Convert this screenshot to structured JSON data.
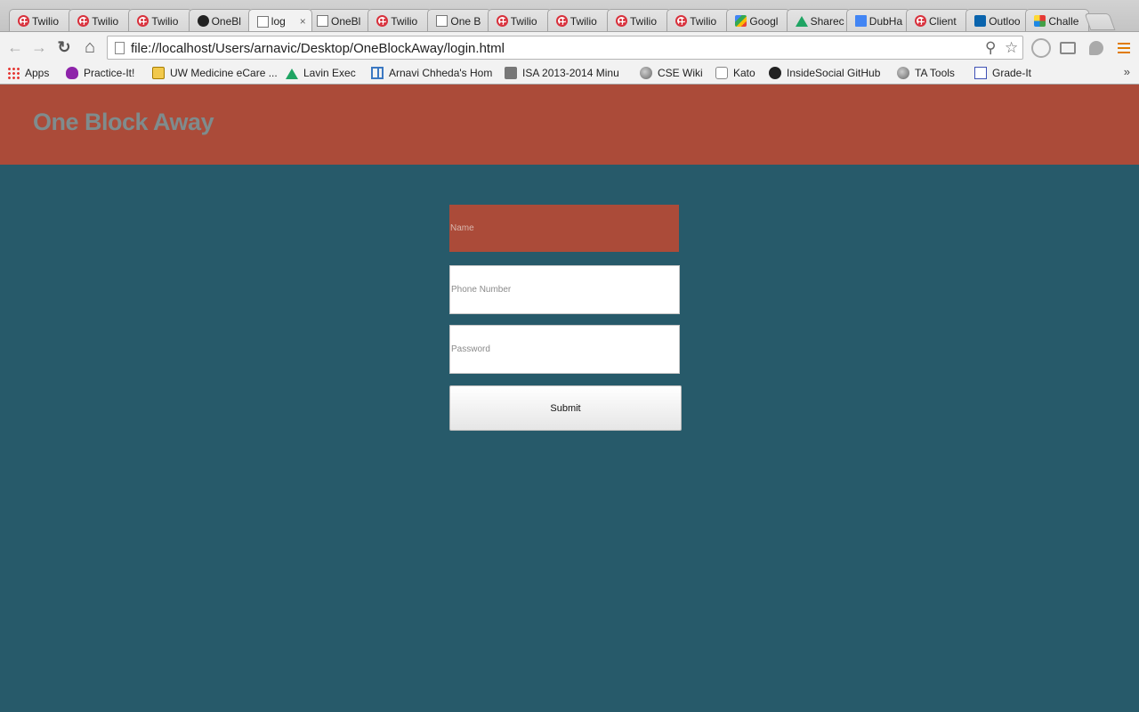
{
  "browser": {
    "tabs": [
      {
        "label": "Twilio",
        "icon": "twilio-icon"
      },
      {
        "label": "Twilio",
        "icon": "twilio-icon"
      },
      {
        "label": "Twilio",
        "icon": "twilio-icon"
      },
      {
        "label": "OneBl",
        "icon": "github-icon"
      },
      {
        "label": "log",
        "icon": "page-icon",
        "active": true
      },
      {
        "label": "OneBl",
        "icon": "page-icon"
      },
      {
        "label": "Twilio",
        "icon": "twilio-icon"
      },
      {
        "label": "One B",
        "icon": "page-icon"
      },
      {
        "label": "Twilio",
        "icon": "twilio-icon"
      },
      {
        "label": "Twilio",
        "icon": "twilio-icon"
      },
      {
        "label": "Twilio",
        "icon": "twilio-icon"
      },
      {
        "label": "Twilio",
        "icon": "twilio-icon"
      },
      {
        "label": "Googl",
        "icon": "google-icon"
      },
      {
        "label": "Sharec",
        "icon": "drive-icon"
      },
      {
        "label": "DubHa",
        "icon": "docs-icon"
      },
      {
        "label": "Client",
        "icon": "twilio-icon"
      },
      {
        "label": "Outloo",
        "icon": "outlook-icon"
      },
      {
        "label": "Challe",
        "icon": "pinwheel-icon"
      }
    ],
    "tab_close_glyph": "×",
    "url": "file://localhost/Users/arnavic/Desktop/OneBlockAway/login.html",
    "nav": {
      "back_glyph": "←",
      "forward_glyph": "→",
      "reload_glyph": "↻",
      "home_glyph": "⌂"
    },
    "omnibox_icons": {
      "search_glyph": "⚲",
      "star_glyph": "☆"
    },
    "bookmarks": [
      {
        "label": "Apps",
        "icon": "apps-grid-icon"
      },
      {
        "label": "Practice-It!",
        "icon": "bug-icon"
      },
      {
        "label": "UW Medicine eCare ...",
        "icon": "uw-icon"
      },
      {
        "label": "Lavin Exec",
        "icon": "drive-icon"
      },
      {
        "label": "Arnavi Chheda's Hom",
        "icon": "table-icon"
      },
      {
        "label": "ISA 2013-2014 Minu",
        "icon": "folder-icon"
      },
      {
        "label": "CSE Wiki",
        "icon": "globe-icon"
      },
      {
        "label": "Kato",
        "icon": "cat-icon"
      },
      {
        "label": "InsideSocial GitHub",
        "icon": "github-icon"
      },
      {
        "label": "TA Tools",
        "icon": "globe-icon"
      },
      {
        "label": "Grade-It",
        "icon": "checkbox-icon"
      }
    ],
    "bookmarks_more": "»"
  },
  "page": {
    "title": "One Block Away",
    "colors": {
      "header": "#ab4b39",
      "background": "#275a6a",
      "title": "#7f8c8d"
    },
    "form": {
      "name_placeholder": "Name",
      "phone_placeholder": "Phone Number",
      "password_placeholder": "Password",
      "submit_label": "Submit"
    }
  }
}
